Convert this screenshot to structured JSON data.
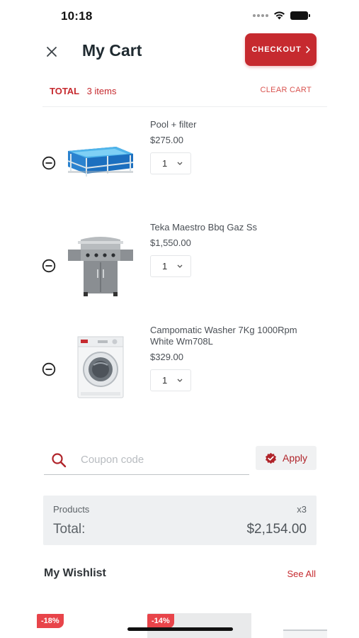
{
  "status_bar": {
    "time": "10:18"
  },
  "header": {
    "title": "My Cart",
    "checkout_label": "CHECKOUT",
    "total_label": "TOTAL",
    "items_count": "3 items",
    "clear_cart_label": "CLEAR CART"
  },
  "cart": {
    "items": [
      {
        "name": "Pool + filter",
        "price": "$275.00",
        "qty": "1",
        "image": "pool-image"
      },
      {
        "name": "Teka Maestro Bbq Gaz Ss",
        "price": "$1,550.00",
        "qty": "1",
        "image": "bbq-grill-image"
      },
      {
        "name": "Campomatic Washer 7Kg 1000Rpm White Wm708L",
        "price": "$329.00",
        "qty": "1",
        "image": "washing-machine-image"
      }
    ]
  },
  "coupon": {
    "placeholder": "Coupon code",
    "apply_label": "Apply"
  },
  "totals": {
    "products_label": "Products",
    "products_qty": "x3",
    "total_label": "Total:",
    "total_value": "$2,154.00"
  },
  "wishlist": {
    "title": "My Wishlist",
    "see_all_label": "See All",
    "badges": [
      "-18%",
      "-14%"
    ]
  },
  "colors": {
    "accent": "#c62a2f",
    "badge": "#e8444a",
    "totals_bg": "#eef0f2"
  }
}
